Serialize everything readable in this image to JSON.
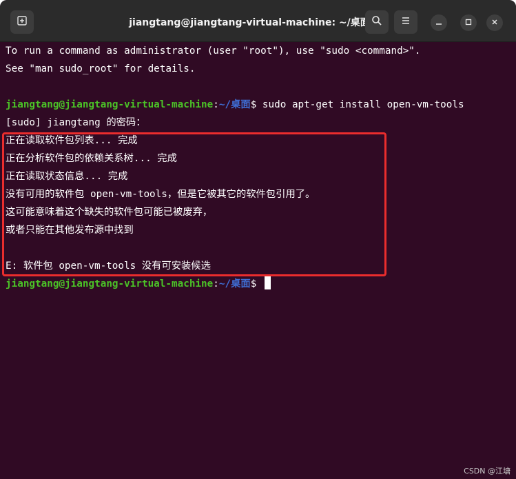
{
  "window": {
    "title": "jiangtang@jiangtang-virtual-machine: ~/桌面"
  },
  "icons": {
    "new_tab": "new-tab-icon",
    "search": "search-icon",
    "menu": "hamburger-menu-icon",
    "minimize": "minimize-icon",
    "maximize": "maximize-icon",
    "close": "close-icon"
  },
  "terminal": {
    "intro_line1": "To run a command as administrator (user \"root\"), use \"sudo <command>\".",
    "intro_line2": "See \"man sudo_root\" for details.",
    "prompt_user": "jiangtang@jiangtang-virtual-machine",
    "prompt_sep": ":",
    "prompt_path": "~/桌面",
    "prompt_dollar": "$ ",
    "command": "sudo apt-get install open-vm-tools",
    "password_prompt": "[sudo] jiangtang 的密码：",
    "output": [
      "正在读取软件包列表... 完成",
      "正在分析软件包的依赖关系树... 完成",
      "正在读取状态信息... 完成",
      "没有可用的软件包 open-vm-tools，但是它被其它的软件包引用了。",
      "这可能意味着这个缺失的软件包可能已被废弃，",
      "或者只能在其他发布源中找到",
      "",
      "E: 软件包 open-vm-tools 没有可安装候选"
    ]
  },
  "watermark": "CSDN @江塘",
  "colors": {
    "terminal_bg": "#300a24",
    "prompt_user": "#4bc227",
    "prompt_path": "#3f6fd6",
    "highlight_box": "#ea2d2d"
  }
}
